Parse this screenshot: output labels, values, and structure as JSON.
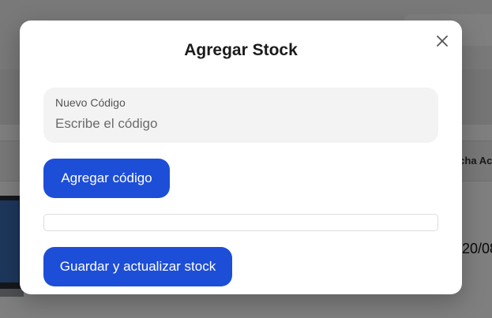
{
  "background": {
    "table_column_header": "Fecha Ac",
    "visible_date": "20/08"
  },
  "modal": {
    "title": "Agregar Stock",
    "close_icon": "close-icon",
    "code_field": {
      "label": "Nuevo Código",
      "value": "",
      "placeholder": "Escribe el código"
    },
    "add_code_label": "Agregar código",
    "codes": [],
    "save_label": "Guardar y actualizar stock"
  },
  "colors": {
    "primary_button": "#1d4ed8",
    "field_background": "#f3f3f3",
    "overlay": "rgba(0,0,0,0.5)"
  }
}
